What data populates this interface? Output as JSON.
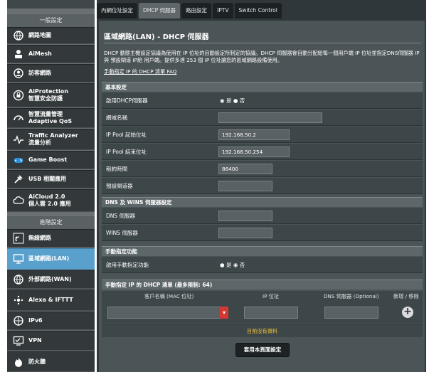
{
  "sidebar": {
    "general_header": "一般設定",
    "advanced_header": "進階設定",
    "items": [
      {
        "label": "網路地圖",
        "sub": ""
      },
      {
        "label": "AiMesh",
        "sub": ""
      },
      {
        "label": "訪客網路",
        "sub": ""
      },
      {
        "label": "AiProtection",
        "sub": "智慧安全防護"
      },
      {
        "label": "智慧流量管理",
        "sub": "Adaptive QoS"
      },
      {
        "label": "Traffic Analyzer",
        "sub": "流量分析"
      },
      {
        "label": "Game Boost",
        "sub": ""
      },
      {
        "label": "USB 相關應用",
        "sub": ""
      },
      {
        "label": "AiCloud 2.0",
        "sub": "個人雲 2.0 應用"
      }
    ],
    "advanced_items": [
      {
        "label": "無線網路"
      },
      {
        "label": "區域網路(LAN)"
      },
      {
        "label": "外部網路(WAN)"
      },
      {
        "label": "Alexa & IFTTT"
      },
      {
        "label": "IPv6"
      },
      {
        "label": "VPN"
      },
      {
        "label": "防火牆"
      }
    ]
  },
  "tabs": [
    "內網位址設定",
    "DHCP 伺服器",
    "路由設定",
    "IPTV",
    "Switch Control"
  ],
  "page": {
    "title": "區域網路(LAN) - DHCP 伺服器",
    "description": "DHCP 動態主機設定協議為使用在 IP 位址的自動設定所制定的協議。DHCP 伺服器會自動分配給每一個用戶端 IP 位址並指定DNS伺服器 IP與 預設閘道 IP給 用戶端。提供多達 253 個 IP 位址讓您的區域網路設備使用。",
    "faq_link": "手動指定 IP 的 DHCP 清單 FAQ"
  },
  "basic": {
    "header": "基本設定",
    "enable_label": "啟用DHCP伺服器",
    "yes": "是",
    "no": "否",
    "domain_label": "網域名稱",
    "domain_value": "",
    "start_label": "IP Pool 起始位址",
    "start_value": "192.168.50.2",
    "end_label": "IP Pool 結束位址",
    "end_value": "192.168.50.254",
    "lease_label": "租約時間",
    "lease_value": "86400",
    "gateway_label": "預設閘道器",
    "gateway_value": ""
  },
  "dns": {
    "header": "DNS 及 WINS 伺服器設定",
    "dns_label": "DNS 伺服器",
    "dns_value": "",
    "wins_label": "WINS 伺服器",
    "wins_value": ""
  },
  "manual": {
    "header": "手動指定功能",
    "enable_label": "啟用手動指定功能",
    "yes": "是",
    "no": "否"
  },
  "list": {
    "header": "手動指定 IP 的 DHCP 清單 (最多限制: 64)",
    "col_client": "客戶名稱 (MAC 位址)",
    "col_ip": "IP 位址",
    "col_dns": "DNS 伺服器 (Optional)",
    "col_action": "新增 / 移除",
    "no_data": "目前沒有資料"
  },
  "apply_label": "套用本頁面設定",
  "colors": {
    "accent": "#5aa0cc",
    "panel": "#4b5457",
    "no_data": "#f2c33a",
    "dropdown": "#d43832"
  }
}
